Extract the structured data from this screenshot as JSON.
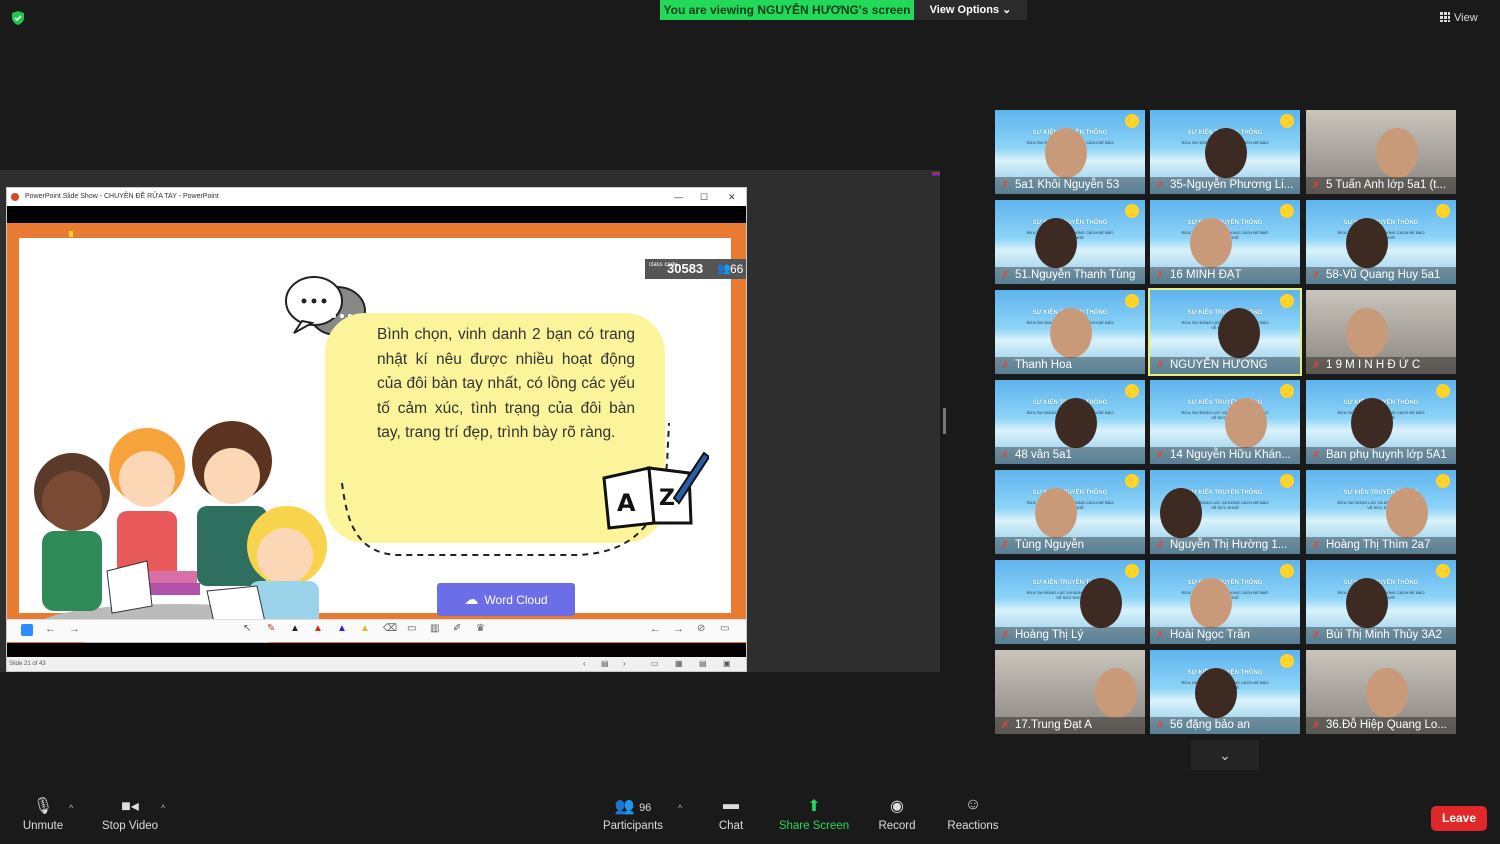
{
  "banner": {
    "text": "You are viewing NGUYỄN HƯƠNG's screen",
    "view_options": "View Options ⌄"
  },
  "top_right": {
    "view_label": "View"
  },
  "ppt": {
    "title": "PowerPoint Slide Show  -  CHUYÊN ĐỀ RỬA TAY  -  PowerPoint",
    "class_code_label": "class code",
    "class_code": "30583",
    "participants_count": "66",
    "bubble_text": "Bình chọn, vinh danh 2 bạn có trang nhật kí nêu được nhiều hoạt động của đôi bàn tay nhất, có lồng các yếu tố cảm xúc, tình trạng của đôi bàn tay, trang trí đẹp, trình bày rõ ràng.",
    "word_cloud_button": "Word Cloud",
    "status": "Slide 21 of 43"
  },
  "participants": [
    {
      "name": "5a1 Khôi Nguyễn 53"
    },
    {
      "name": "35-Nguyễn Phương Li..."
    },
    {
      "name": "5 Tuấn Anh lớp 5a1 (t..."
    },
    {
      "name": "51.Nguyễn Thanh Tùng"
    },
    {
      "name": "16 MINH ĐẠT"
    },
    {
      "name": "58-Vũ Quang Huy 5a1"
    },
    {
      "name": "Thanh Hoa"
    },
    {
      "name": "NGUYỄN HƯƠNG"
    },
    {
      "name": "1 9 M I N H Đ Ứ C"
    },
    {
      "name": "48 vân 5a1"
    },
    {
      "name": "14 Nguyễn Hữu Khán..."
    },
    {
      "name": "Ban phụ huynh lớp 5A1"
    },
    {
      "name": "Tùng Nguyễn"
    },
    {
      "name": "Nguyễn Thị Hường 1..."
    },
    {
      "name": "Hoàng Thị Thìm 2a7"
    },
    {
      "name": "Hoàng Thị Lý"
    },
    {
      "name": "Hoài Ngọc Trần"
    },
    {
      "name": "Bùi Thị Minh Thủy 3A2"
    },
    {
      "name": "17.Trung Đạt A"
    },
    {
      "name": "56 đặng  bảo an"
    },
    {
      "name": "36.Đỗ Hiệp Quang Lo..."
    }
  ],
  "tile_text": {
    "headline": "SỰ KIỆN TRUYỀN THÔNG",
    "sub": "RỬA TAY ĐÚNG LÚC VÀ ĐÚNG CÁCH ĐỂ BẢO VỆ SỨC KHOẺ"
  },
  "toolbar": {
    "unmute": "Unmute",
    "stop_video": "Stop Video",
    "participants": "Participants",
    "participants_count": "96",
    "chat": "Chat",
    "share_screen": "Share Screen",
    "record": "Record",
    "reactions": "Reactions",
    "leave": "Leave"
  }
}
